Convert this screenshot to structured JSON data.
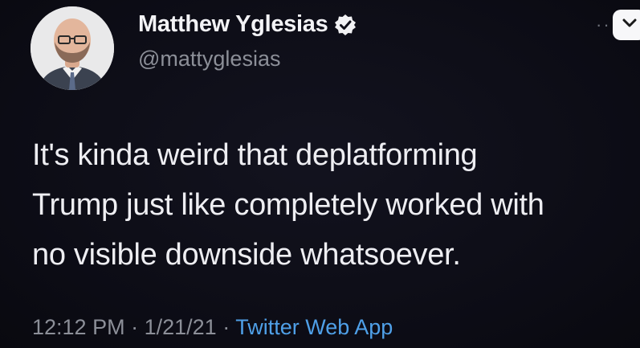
{
  "author": {
    "display_name": "Matthew Yglesias",
    "handle": "@mattyglesias",
    "verified": true,
    "avatar": "profile-photo"
  },
  "tweet": {
    "lines": [
      "It's kinda weird that deplatforming",
      "Trump just like completely worked with",
      "no visible downside whatsoever."
    ]
  },
  "meta": {
    "time": "12:12 PM",
    "separator": "·",
    "date": "1/21/21",
    "source": "Twitter Web App"
  },
  "icons": {
    "verified": "verified-badge-icon",
    "menu": "chevron-down-icon",
    "more": "more-dots-icon"
  },
  "colors": {
    "background": "#0e0e18",
    "text": "#eeeef2",
    "secondary": "#8c8f98",
    "link": "#4fa0e8"
  }
}
